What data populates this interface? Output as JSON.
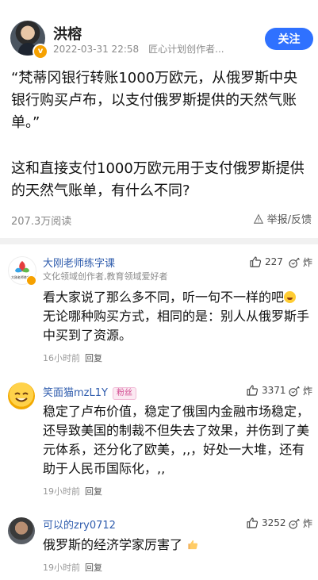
{
  "post": {
    "author": "洪榕",
    "datetime": "2022-03-31 22:58",
    "source": "匠心计划创作者...",
    "follow_label": "关注",
    "quote": "“梵蒂冈银行转账1000万欧元，从俄罗斯中央银行购买卢布，以支付俄罗斯提供的天然气账单。”",
    "question": "这和直接支付1000万欧元用于支付俄罗斯提供的天然气账单，有什么不同?",
    "reads": "207.3万阅读",
    "report_label": "举报/反馈"
  },
  "comments": [
    {
      "name": "大刚老师练字课",
      "subtitle": "文化领域创作者,教育领域爱好者",
      "likes": "227",
      "boom_label": "炸",
      "text": "看大家说了那么多不同，听一句不一样的吧",
      "text2": "无论哪种购买方式，相同的是：别人从俄罗斯手中买到了资源。",
      "time": "16小时前",
      "reply_label": "回复",
      "avatar_caption": "大刚老师练字课"
    },
    {
      "name": "笑面猫mzL1Y",
      "badge": "粉丝",
      "likes": "3371",
      "boom_label": "炸",
      "text": "稳定了卢布价值，稳定了俄国内金融市场稳定，还导致美国的制裁不但失去了效果，并伤到了美元体系，还分化了欧美，,,，好处一大堆，还有助于人民币国际化，,,",
      "time": "19小时前",
      "reply_label": "回复"
    },
    {
      "name": "可以的zry0712",
      "likes": "3252",
      "boom_label": "炸",
      "text": "俄罗斯的经济学家厉害了",
      "time": "19小时前",
      "reply_label": "回复"
    }
  ],
  "colors": {
    "accent": "#2f71ff",
    "name_blue": "#2f5cad",
    "badge_pink": "#d1488e"
  }
}
